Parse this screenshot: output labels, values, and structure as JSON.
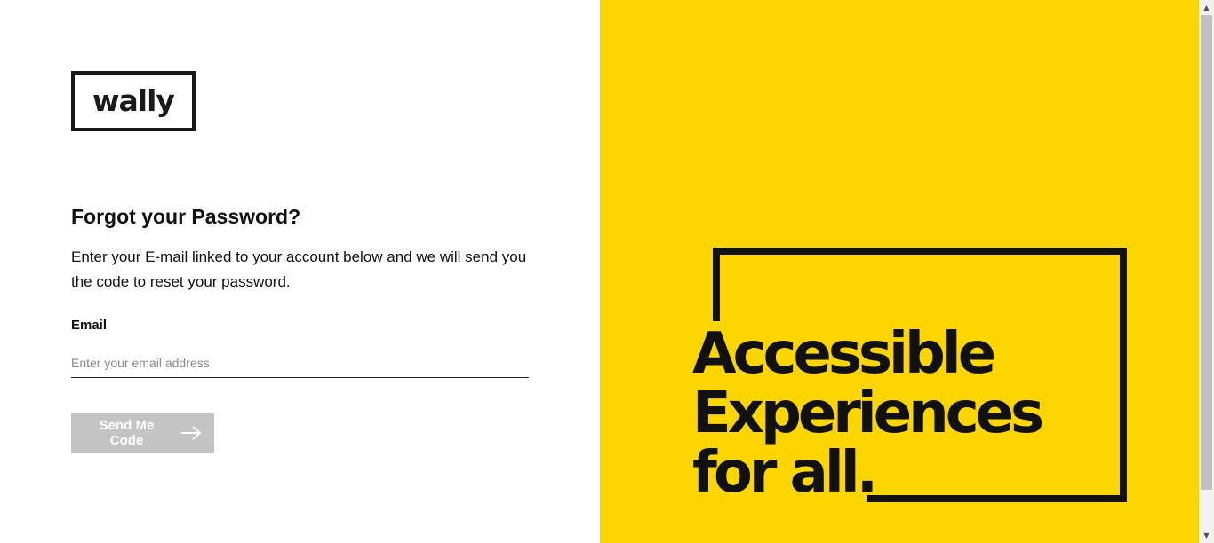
{
  "brand": {
    "logo_text": "wally"
  },
  "form": {
    "heading": "Forgot your Password?",
    "description": "Enter your E-mail linked to your account below and we will send you the code to reset your password.",
    "email_label": "Email",
    "email_value": "",
    "email_placeholder": "Enter your email address",
    "submit_label": "Send Me Code",
    "submit_icon": "arrow-right-icon"
  },
  "promo": {
    "line1": "Accessible",
    "line2": "Experiences",
    "line3": "for all."
  },
  "colors": {
    "accent": "#fdd500",
    "text": "#111111",
    "button_disabled": "#c4c4c4"
  }
}
